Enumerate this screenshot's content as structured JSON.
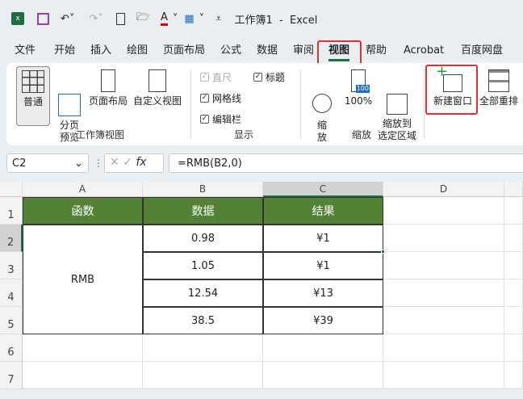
{
  "title": "工作簿1  -  Excel",
  "menu_tabs": [
    "文件",
    "开始",
    "插入",
    "绘图",
    "页面布局",
    "公式",
    "数据",
    "审阅",
    "视图",
    "帮助",
    "Acrobat",
    "百度网盘"
  ],
  "active_tab": "视图",
  "ribbon": {
    "workbook_views": {
      "label": "工作簿视图",
      "normal": "普通",
      "page_break": "分页\n预览",
      "page_layout": "页面布局",
      "custom": "自定义视图"
    },
    "show": {
      "label": "显示",
      "ruler": "直尺",
      "gridlines": "网格线",
      "formula_bar": "编辑栏",
      "headings": "标题"
    },
    "zoom": {
      "label": "缩放",
      "zoom": "缩\n放",
      "zoom100": "100%",
      "zoom_sel": "缩放到\n选定区域",
      "badge": "100"
    },
    "window": {
      "new_window": "新建窗口",
      "arrange_all": "全部重排"
    }
  },
  "formula_bar": {
    "name_box": "C2",
    "fx": "fx",
    "formula": "=RMB(B2,0)"
  },
  "columns": [
    "A",
    "B",
    "C",
    "D"
  ],
  "rows": [
    "1",
    "2",
    "3",
    "4",
    "5",
    "6",
    "7"
  ],
  "table": {
    "headers": [
      "函数",
      "数据",
      "结果"
    ],
    "a_merged": "RMB",
    "b": [
      "0.98",
      "1.05",
      "12.54",
      "38.5"
    ],
    "c": [
      "¥1",
      "¥1",
      "¥13",
      "¥39"
    ]
  },
  "colors": {
    "header_green": "#548235",
    "highlight_red": "#e03030"
  }
}
